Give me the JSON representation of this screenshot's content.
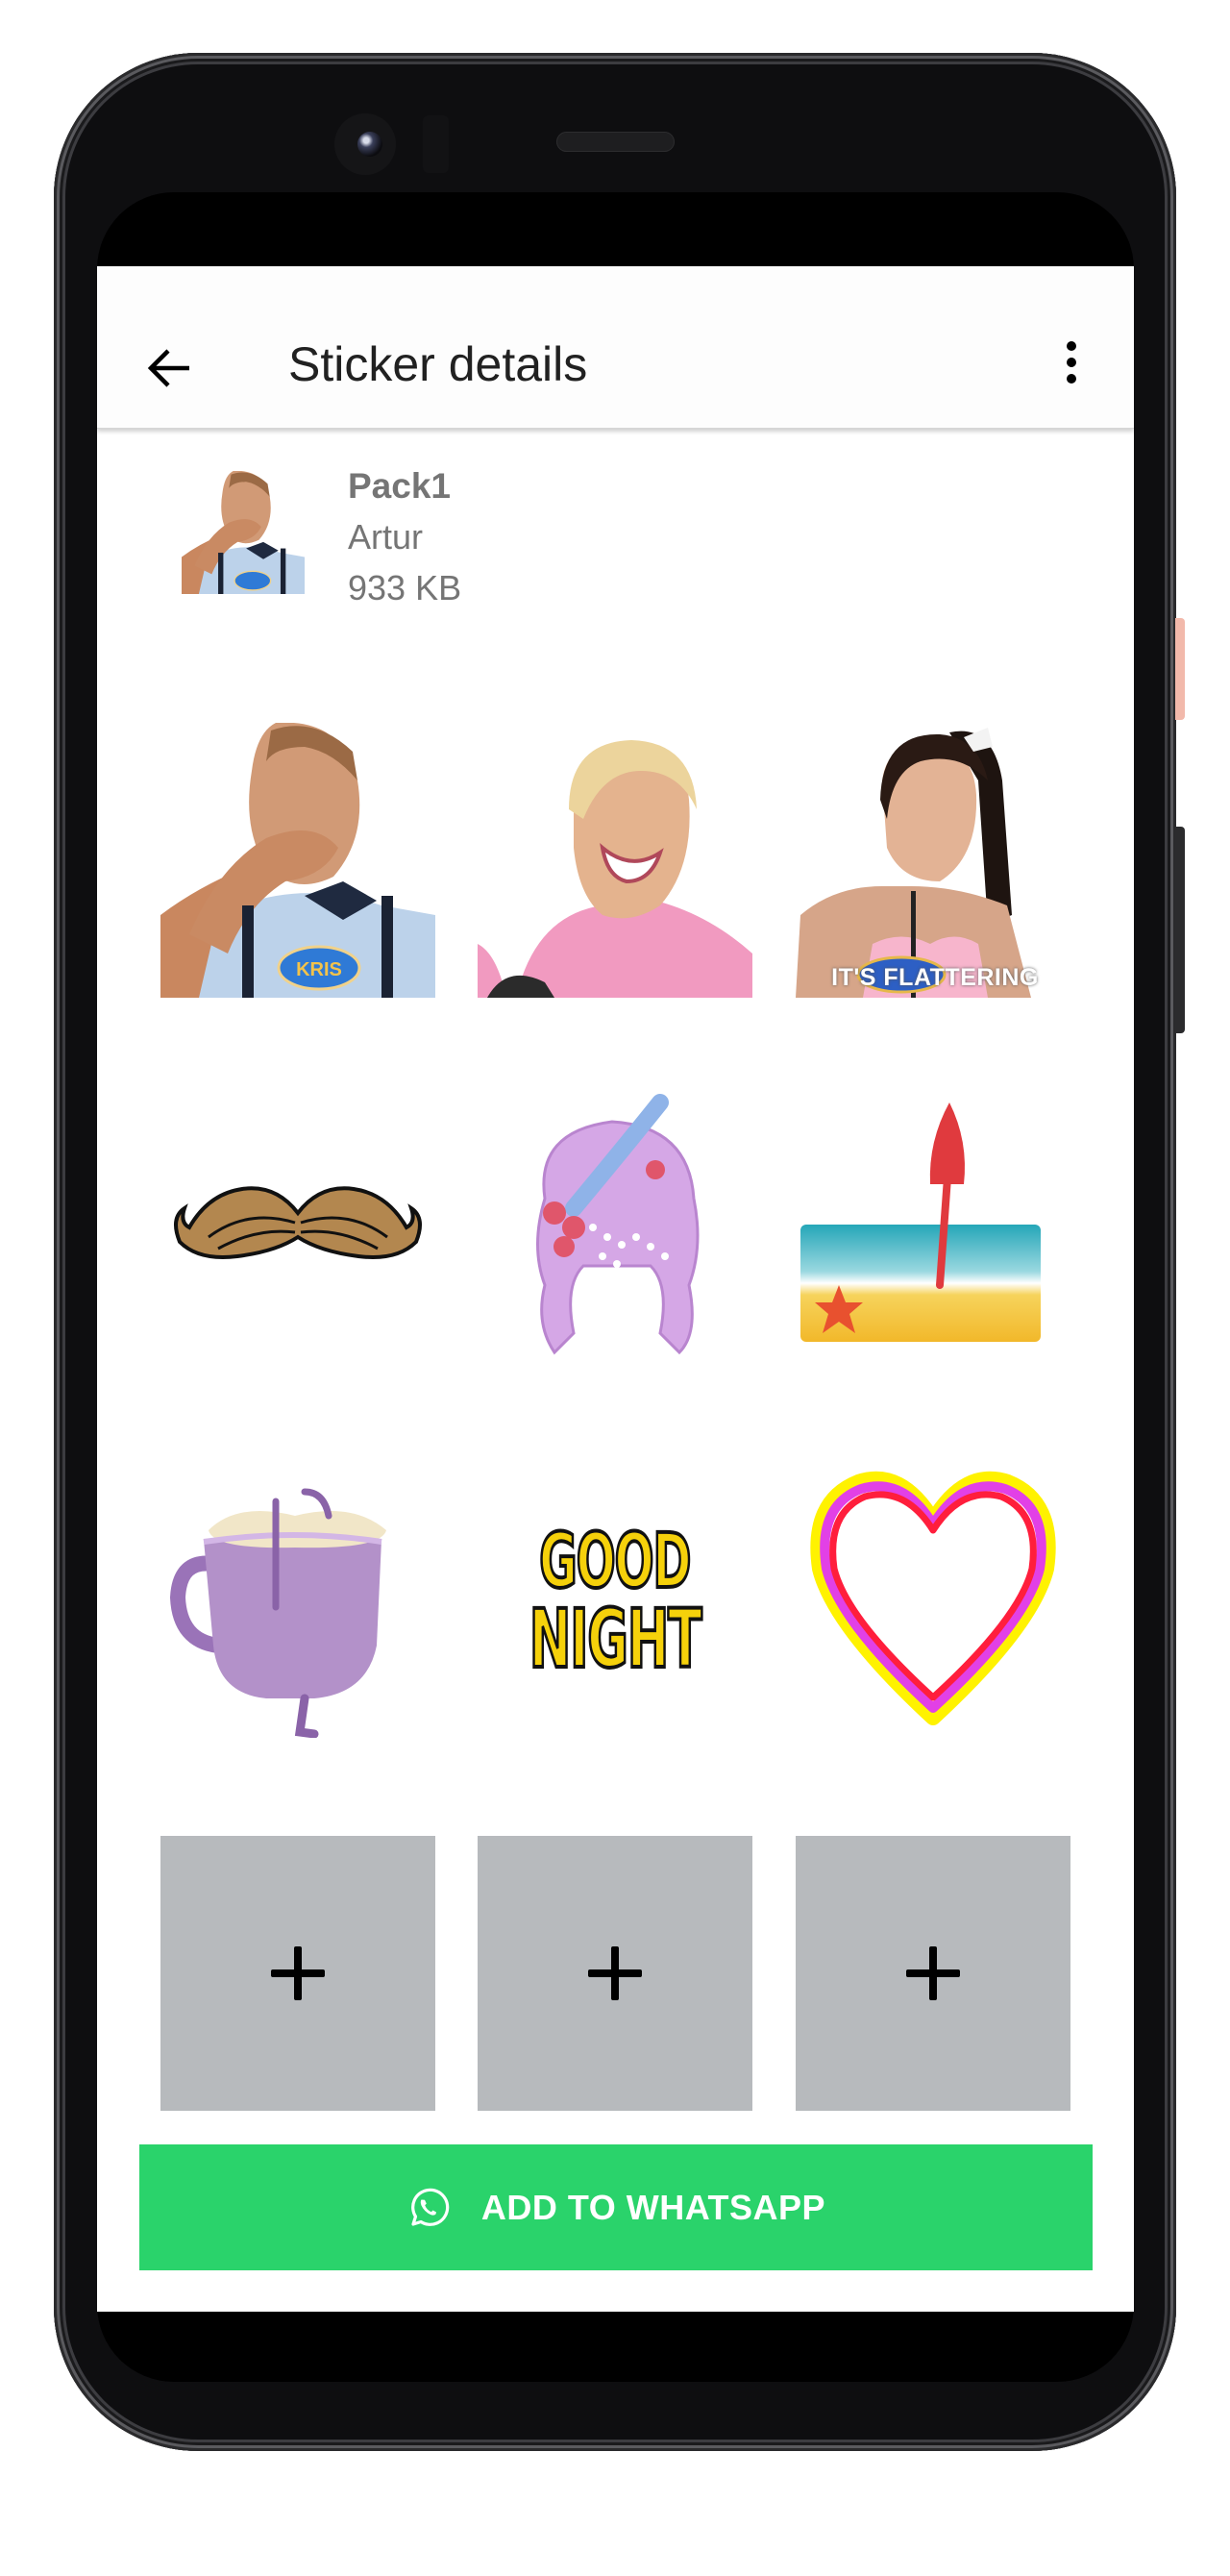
{
  "app": {
    "header": {
      "title": "Sticker details",
      "back_icon": "arrow-left-icon",
      "menu_icon": "more-vertical-icon"
    },
    "pack": {
      "name": "Pack1",
      "publisher": "Artur",
      "size": "933 KB",
      "tray_icon": "man-covering-mouth-sticker"
    },
    "stickers": [
      {
        "name": "man-covering-mouth-sticker",
        "caption": "KRIS"
      },
      {
        "name": "blond-man-pink-hoodie-sticker",
        "caption": ""
      },
      {
        "name": "woman-its-flattering-sticker",
        "caption": "IT'S FLATTERING"
      },
      {
        "name": "mustache-sticker",
        "caption": ""
      },
      {
        "name": "lilac-wig-sticker",
        "caption": ""
      },
      {
        "name": "beach-umbrella-sticker",
        "caption": ""
      },
      {
        "name": "dancing-cup-sticker",
        "caption": ""
      },
      {
        "name": "good-night-sticker",
        "caption": "GOOD NIGHT",
        "line1": "GOOD",
        "line2": "NIGHT"
      },
      {
        "name": "rainbow-heart-sticker",
        "caption": ""
      }
    ],
    "add_slots": [
      {
        "icon": "plus-icon"
      },
      {
        "icon": "plus-icon"
      },
      {
        "icon": "plus-icon"
      }
    ],
    "add_button": {
      "label": "ADD TO WHATSAPP",
      "icon": "whatsapp-icon",
      "color": "#2AD36B"
    }
  },
  "colors": {
    "accent_green": "#2AD36B",
    "text_secondary": "#757575",
    "add_tile": "#B7BABD"
  }
}
